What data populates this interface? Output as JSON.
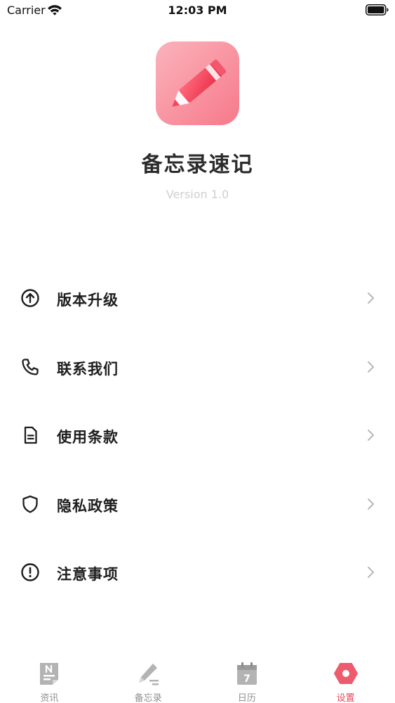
{
  "status_bar": {
    "carrier": "Carrier",
    "time": "12:03 PM",
    "wifi_icon": "wifi-icon",
    "battery_icon": "battery-icon"
  },
  "header": {
    "app_name": "备忘录速记",
    "version": "Version 1.0",
    "logo_icon": "pencil-icon",
    "logo_colors": [
      "#f9a2ae",
      "#f0485e"
    ]
  },
  "menu": {
    "items": [
      {
        "label": "版本升级",
        "icon": "arrow-up-circle-icon"
      },
      {
        "label": "联系我们",
        "icon": "phone-icon"
      },
      {
        "label": "使用条款",
        "icon": "document-icon"
      },
      {
        "label": "隐私政策",
        "icon": "shield-icon"
      },
      {
        "label": "注意事项",
        "icon": "alert-circle-icon"
      }
    ],
    "chevron_icon": "chevron-right-icon"
  },
  "tab_bar": {
    "tabs": [
      {
        "label": "资讯",
        "icon": "news-icon",
        "active": false
      },
      {
        "label": "备忘录",
        "icon": "memo-pen-icon",
        "active": false
      },
      {
        "label": "日历",
        "icon": "calendar-icon",
        "active": false,
        "icon_text": "7"
      },
      {
        "label": "设置",
        "icon": "settings-hexagon-icon",
        "active": true
      }
    ],
    "active_color": "#e8475c",
    "inactive_color": "#b3b3b3"
  }
}
